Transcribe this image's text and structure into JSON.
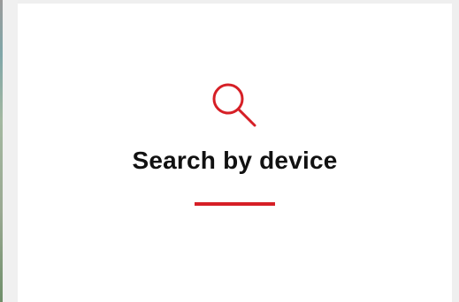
{
  "card": {
    "title": "Search by device",
    "icon": "search-icon"
  },
  "colors": {
    "accent": "#d61f26",
    "text": "#111111",
    "card_background": "#ffffff",
    "page_background": "#efefef"
  }
}
